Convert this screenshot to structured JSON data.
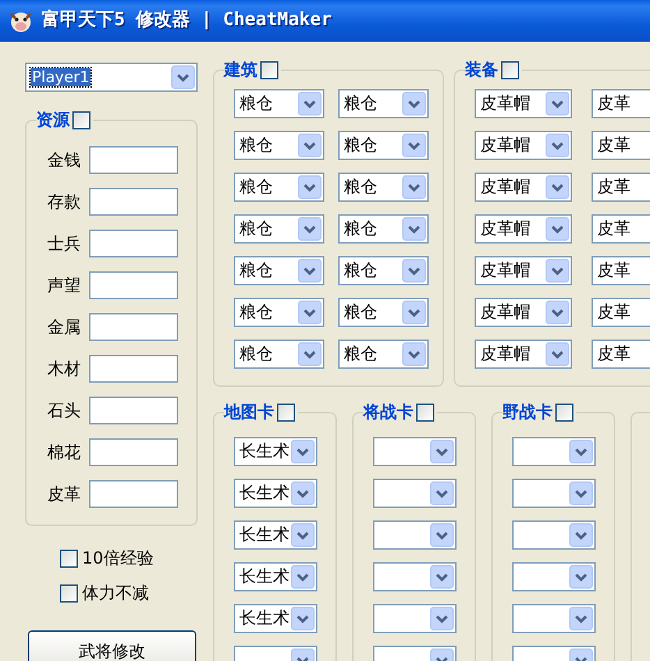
{
  "window": {
    "title": "富甲天下5 修改器 | CheatMaker"
  },
  "player_select": {
    "value": "Player1"
  },
  "resources": {
    "label": "资源",
    "checked": false,
    "fields": [
      {
        "label": "金钱"
      },
      {
        "label": "存款"
      },
      {
        "label": "士兵"
      },
      {
        "label": "声望"
      },
      {
        "label": "金属"
      },
      {
        "label": "木材"
      },
      {
        "label": "石头"
      },
      {
        "label": "棉花"
      },
      {
        "label": "皮革"
      }
    ]
  },
  "options": [
    {
      "label": "10倍经验",
      "checked": false
    },
    {
      "label": "体力不减",
      "checked": false
    }
  ],
  "general_button": "武将修改",
  "buildings": {
    "label": "建筑",
    "checked": false,
    "rows": [
      [
        "粮仓",
        "粮仓"
      ],
      [
        "粮仓",
        "粮仓"
      ],
      [
        "粮仓",
        "粮仓"
      ],
      [
        "粮仓",
        "粮仓"
      ],
      [
        "粮仓",
        "粮仓"
      ],
      [
        "粮仓",
        "粮仓"
      ],
      [
        "粮仓",
        "粮仓"
      ]
    ]
  },
  "equipment": {
    "label": "装备",
    "checked": false,
    "rows": [
      [
        "皮革帽",
        "皮革"
      ],
      [
        "皮革帽",
        "皮革"
      ],
      [
        "皮革帽",
        "皮革"
      ],
      [
        "皮革帽",
        "皮革"
      ],
      [
        "皮革帽",
        "皮革"
      ],
      [
        "皮革帽",
        "皮革"
      ],
      [
        "皮革帽",
        "皮革"
      ]
    ]
  },
  "card_groups": [
    {
      "label": "地图卡",
      "checked": false,
      "slots": [
        {
          "kind": "filled",
          "value": "长生术"
        },
        {
          "kind": "filled",
          "value": "长生术"
        },
        {
          "kind": "filled",
          "value": "长生术"
        },
        {
          "kind": "filled",
          "value": "长生术"
        },
        {
          "kind": "filled",
          "value": "长生术"
        },
        {
          "kind": "empty"
        }
      ]
    },
    {
      "label": "将战卡",
      "checked": false,
      "slots": [
        {
          "kind": "empty"
        },
        {
          "kind": "empty"
        },
        {
          "kind": "empty"
        },
        {
          "kind": "empty"
        },
        {
          "kind": "empty"
        },
        {
          "kind": "empty"
        }
      ]
    },
    {
      "label": "野战卡",
      "checked": false,
      "slots": [
        {
          "kind": "empty"
        },
        {
          "kind": "empty"
        },
        {
          "kind": "empty"
        },
        {
          "kind": "empty"
        },
        {
          "kind": "empty"
        },
        {
          "kind": "empty"
        }
      ]
    }
  ]
}
